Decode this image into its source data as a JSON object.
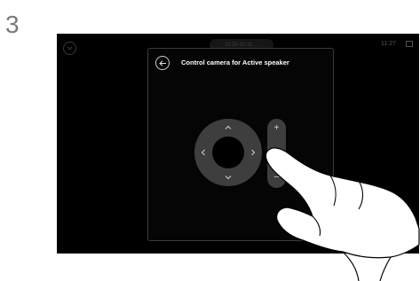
{
  "step": {
    "number": "3"
  },
  "status_bar": {
    "meeting_time": "10:10-10:11 ...",
    "clock": "11:27"
  },
  "panel": {
    "title": "Control camera for Active speaker"
  },
  "zoom": {
    "plus": "+",
    "minus": "–"
  },
  "icons": {
    "back": "arrow-left-icon",
    "pan_up": "chevron-up-icon",
    "pan_down": "chevron-down-icon",
    "pan_left": "chevron-left-icon",
    "pan_right": "chevron-right-icon"
  },
  "colors": {
    "screen_bg": "#000000",
    "control_bg": "#3e3e3e",
    "text": "#ffffff"
  }
}
